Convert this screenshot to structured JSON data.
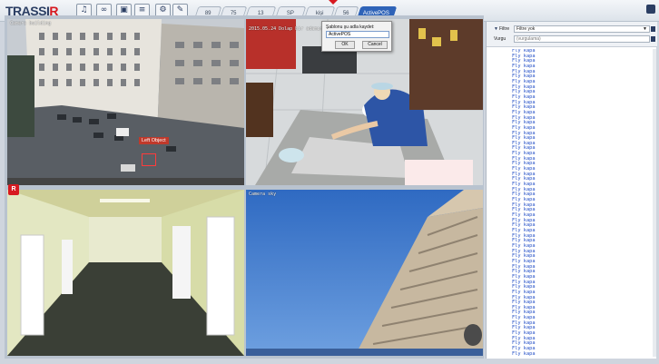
{
  "app": {
    "logo_left": "TRASSI",
    "logo_right": "R"
  },
  "toolbar": {
    "buttons": [
      {
        "name": "bell-button",
        "glyph": "♪"
      },
      {
        "name": "tape-button",
        "glyph": "∞"
      },
      {
        "name": "monitor-button",
        "glyph": "▣"
      },
      {
        "name": "layout-button",
        "glyph": "≣"
      },
      {
        "name": "ptz-button",
        "glyph": "✐"
      },
      {
        "name": "edit-button",
        "glyph": "✎"
      }
    ]
  },
  "tabs": [
    "89",
    "75",
    "13",
    "SP",
    "kişi",
    "56",
    "ActivePOS"
  ],
  "active_tab": "ActivePOS",
  "cameras": [
    {
      "title": "Camera building",
      "event_label": "Left Object"
    },
    {
      "title": "2015.05.24 Dolap bir adamın"
    },
    {
      "title": ""
    },
    {
      "title": "Camera sky"
    }
  ],
  "dialog": {
    "title": "Şablonu şu adla kaydet:",
    "value": "ActivePOS",
    "ok": "OK",
    "cancel": "Cancel"
  },
  "panel": {
    "filter_label": "Filtre",
    "filter_value": "Filtre yok",
    "search_label": "Vurgu",
    "search_placeholder": "(vurgulama)",
    "log_line": "Fly kapa",
    "log_count": 60
  }
}
